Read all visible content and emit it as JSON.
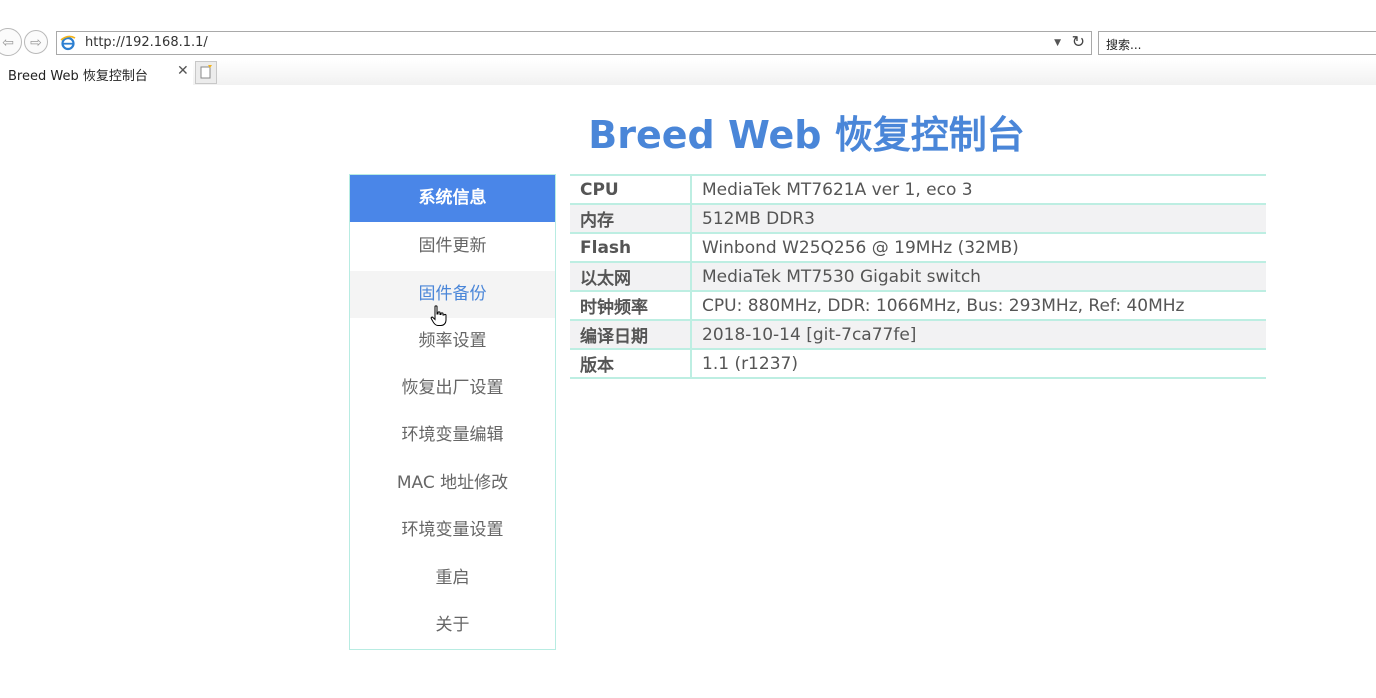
{
  "browser": {
    "back_glyph": "⇦",
    "forward_glyph": "⇨",
    "address": "http://192.168.1.1/",
    "address_dropdown": "▼",
    "refresh_glyph": "↻",
    "search_placeholder": "搜索...",
    "tab_title": "Breed Web 恢复控制台",
    "tab_close": "✕",
    "new_tab_glyph": "▫",
    "favicon": "ie-icon"
  },
  "page": {
    "title": "Breed Web 恢复控制台"
  },
  "sidebar": {
    "items": [
      {
        "label": "系统信息",
        "state": "active"
      },
      {
        "label": "固件更新",
        "state": ""
      },
      {
        "label": "固件备份",
        "state": "hover"
      },
      {
        "label": "频率设置",
        "state": ""
      },
      {
        "label": "恢复出厂设置",
        "state": ""
      },
      {
        "label": "环境变量编辑",
        "state": ""
      },
      {
        "label": "MAC 地址修改",
        "state": ""
      },
      {
        "label": "环境变量设置",
        "state": ""
      },
      {
        "label": "重启",
        "state": ""
      },
      {
        "label": "关于",
        "state": ""
      }
    ]
  },
  "info": {
    "rows": [
      {
        "key": "CPU",
        "value": "MediaTek MT7621A ver 1, eco 3"
      },
      {
        "key": "内存",
        "value": "512MB DDR3"
      },
      {
        "key": "Flash",
        "value": "Winbond W25Q256 @ 19MHz (32MB)"
      },
      {
        "key": "以太网",
        "value": "MediaTek MT7530 Gigabit switch"
      },
      {
        "key": "时钟频率",
        "value": "CPU: 880MHz, DDR: 1066MHz, Bus: 293MHz, Ref: 40MHz"
      },
      {
        "key": "编译日期",
        "value": "2018-10-14 [git-7ca77fe]"
      },
      {
        "key": "版本",
        "value": "1.1 (r1237)"
      }
    ]
  },
  "colors": {
    "accent": "#4a86e8",
    "title": "#4a86d8",
    "border": "#bdeee2"
  }
}
